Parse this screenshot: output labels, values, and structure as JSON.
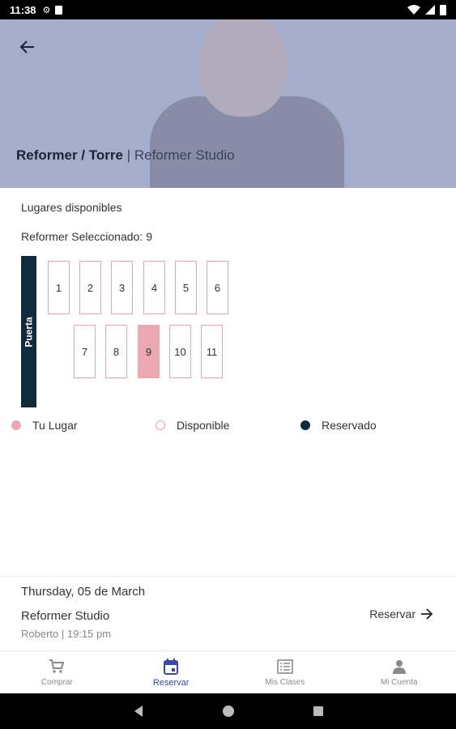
{
  "status_bar": {
    "time": "11:38",
    "icons": [
      "gear-icon",
      "sim-icon",
      "wifi-icon",
      "signal-icon",
      "battery-icon"
    ]
  },
  "header": {
    "title_main": "Reformer / Torre",
    "separator": "|",
    "title_studio": "Reformer Studio",
    "back_icon": "arrow-left-icon"
  },
  "availability": {
    "heading": "Lugares disponibles",
    "selected_label": "Reformer Seleccionado:",
    "selected_value": "9",
    "door_label": "Puerta"
  },
  "seats": [
    {
      "number": "1",
      "state": "available"
    },
    {
      "number": "2",
      "state": "available"
    },
    {
      "number": "3",
      "state": "available"
    },
    {
      "number": "4",
      "state": "available"
    },
    {
      "number": "5",
      "state": "available"
    },
    {
      "number": "6",
      "state": "available"
    },
    {
      "number": "7",
      "state": "available"
    },
    {
      "number": "8",
      "state": "available"
    },
    {
      "number": "9",
      "state": "selected"
    },
    {
      "number": "10",
      "state": "available"
    },
    {
      "number": "11",
      "state": "available"
    }
  ],
  "legend": {
    "mine": "Tu Lugar",
    "available": "Disponible",
    "reserved": "Reservado"
  },
  "colors": {
    "selected": "#eba8b2",
    "reserved": "#122b3a",
    "accent": "#3a48a8"
  },
  "booking": {
    "date": "Thursday, 05 de March",
    "studio": "Reformer Studio",
    "info": "Roberto | 19:15 pm",
    "reserve_label": "Reservar"
  },
  "nav": {
    "items": [
      {
        "label": "Comprar",
        "icon": "cart-icon"
      },
      {
        "label": "Reservar",
        "icon": "calendar-icon",
        "active": true
      },
      {
        "label": "Mis Clases",
        "icon": "list-icon"
      },
      {
        "label": "Mi Cuenta",
        "icon": "person-icon"
      }
    ]
  }
}
